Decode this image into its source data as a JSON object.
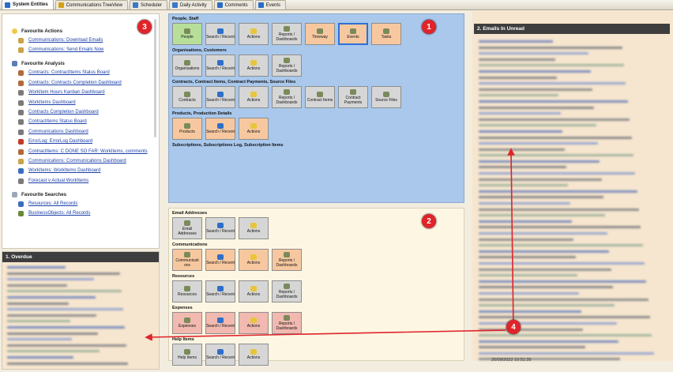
{
  "tabs": [
    {
      "label": "System Entities",
      "icon": "grid-icon",
      "color": "#2b6cc4"
    },
    {
      "label": "Communications TreeView",
      "icon": "envelope-icon",
      "color": "#d4a017"
    },
    {
      "label": "Scheduler",
      "icon": "calendar-icon",
      "color": "#3a78c8"
    },
    {
      "label": "Daily Activity",
      "icon": "calendar-icon",
      "color": "#3a78c8"
    },
    {
      "label": "Comments",
      "icon": "comment-icon",
      "color": "#2b6cc4"
    },
    {
      "label": "Events",
      "icon": "document-icon",
      "color": "#2b6cc4"
    }
  ],
  "favourites": {
    "actions_title": "Favourite Actions",
    "actions": [
      "Communications: Download Emails",
      "Communications: Send Emails Now"
    ],
    "analysis_title": "Favourite Analysis",
    "analysis": [
      "Contracts: ContractItems Status Board",
      "Contracts: Contracts Completion Dashboard",
      "WorkItem Hours Kanban Dashboard",
      "WorkItems Dashboard",
      "Contracts Completion Dashboard",
      "ContractItems Status Board",
      "Communications Dashboard",
      "ErrorLog: ErrorLog Dashboard",
      "ContractItems: C DONE SO FAR: WorkItems, comments",
      "Communications: Communications Dashboard",
      "WorkItems: WorkItems Dashboard",
      "Forecast v Actual WorkItems"
    ],
    "searches_title": "Favourite Searches",
    "searches": [
      "Resources: All Records",
      "BusinessObjects: All Records"
    ]
  },
  "overdue": {
    "title": "1. Overdue"
  },
  "emails": {
    "title": "2. Emails In Unread",
    "last_timestamp": "20/09/2022 10:51:39"
  },
  "groups": {
    "people_staff": {
      "title": "People, Staff",
      "tiles": [
        {
          "label": "People",
          "color": "t-green",
          "icon": "people-icon"
        },
        {
          "label": "Search / Recent",
          "color": "t-grey",
          "icon": "search-icon"
        },
        {
          "label": "Actions",
          "color": "t-grey",
          "icon": "bulb-icon"
        },
        {
          "label": "Reports / Dashboards",
          "color": "t-grey",
          "icon": "chart-icon"
        },
        {
          "label": "Timeway",
          "color": "t-peach",
          "icon": "timeway-icon"
        },
        {
          "label": "Events",
          "color": "t-peach",
          "icon": "events-icon",
          "selected": true
        },
        {
          "label": "Tasks",
          "color": "t-peach",
          "icon": "tasks-icon"
        }
      ]
    },
    "organisations": {
      "title": "Organisations, Customers",
      "tiles": [
        {
          "label": "Organisations",
          "color": "t-grey",
          "icon": "building-icon"
        },
        {
          "label": "Search / Recent",
          "color": "t-grey",
          "icon": "search-icon"
        },
        {
          "label": "Actions",
          "color": "t-grey",
          "icon": "bulb-icon"
        },
        {
          "label": "Reports / Dashboards",
          "color": "t-grey",
          "icon": "chart-icon"
        }
      ]
    },
    "contracts": {
      "title": "Contracts, Contract Items, Contract Payments, Source Files",
      "tiles": [
        {
          "label": "Contracts",
          "color": "t-grey",
          "icon": "contract-icon"
        },
        {
          "label": "Search / Recent",
          "color": "t-grey",
          "icon": "search-icon"
        },
        {
          "label": "Actions",
          "color": "t-grey",
          "icon": "bulb-icon"
        },
        {
          "label": "Reports / Dashboards",
          "color": "t-grey",
          "icon": "chart-icon"
        },
        {
          "label": "Contract Items",
          "color": "t-grey",
          "icon": "contract-icon"
        },
        {
          "label": "Contract Payments",
          "color": "t-grey",
          "icon": "payment-icon"
        },
        {
          "label": "Source Files",
          "color": "t-grey",
          "icon": "folder-icon"
        }
      ]
    },
    "products": {
      "title": "Products, Production Details",
      "tiles": [
        {
          "label": "Products",
          "color": "t-peach",
          "icon": "product-icon"
        },
        {
          "label": "Search / Recent",
          "color": "t-peach",
          "icon": "search-icon"
        },
        {
          "label": "Actions",
          "color": "t-peach",
          "icon": "bulb-icon"
        }
      ]
    },
    "subscriptions": {
      "title": "Subscriptions, Subscriptions Log, Subscription Items"
    },
    "email_addresses": {
      "title": "Email Addresses",
      "tiles": [
        {
          "label": "Email Addresses",
          "color": "t-grey",
          "icon": "email-icon"
        },
        {
          "label": "Search / Recent",
          "color": "t-grey",
          "icon": "search-icon"
        },
        {
          "label": "Actions",
          "color": "t-grey",
          "icon": "bulb-icon"
        }
      ]
    },
    "communications": {
      "title": "Communications",
      "tiles": [
        {
          "label": "Communicati ons",
          "color": "t-peach",
          "icon": "envelope-icon"
        },
        {
          "label": "Search / Recent",
          "color": "t-peach",
          "icon": "search-icon"
        },
        {
          "label": "Actions",
          "color": "t-peach",
          "icon": "bulb-icon"
        },
        {
          "label": "Reports / Dashboards",
          "color": "t-peach",
          "icon": "chart-icon"
        }
      ]
    },
    "resources": {
      "title": "Resources",
      "tiles": [
        {
          "label": "Resources",
          "color": "t-grey",
          "icon": "database-icon"
        },
        {
          "label": "Search / Recent",
          "color": "t-grey",
          "icon": "search-icon"
        },
        {
          "label": "Actions",
          "color": "t-grey",
          "icon": "bulb-icon"
        },
        {
          "label": "Reports / Dashboards",
          "color": "t-grey",
          "icon": "chart-icon"
        }
      ]
    },
    "expenses": {
      "title": "Expenses",
      "tiles": [
        {
          "label": "Expenses",
          "color": "t-salmon",
          "icon": "expense-icon"
        },
        {
          "label": "Search / Recent",
          "color": "t-salmon",
          "icon": "search-icon"
        },
        {
          "label": "Actions",
          "color": "t-salmon",
          "icon": "bulb-icon"
        },
        {
          "label": "Reports / Dashboards",
          "color": "t-salmon",
          "icon": "chart-icon"
        }
      ]
    },
    "help_items": {
      "title": "Help Items",
      "tiles": [
        {
          "label": "Help Items",
          "color": "t-grey",
          "icon": "help-icon"
        },
        {
          "label": "Search / Recent",
          "color": "t-grey",
          "icon": "search-icon"
        },
        {
          "label": "Actions",
          "color": "t-grey",
          "icon": "bulb-icon"
        }
      ]
    }
  },
  "markers": [
    "1",
    "2",
    "3",
    "4"
  ],
  "colors": {
    "accent_red": "#e0242a",
    "link_blue": "#1b3fa8",
    "group_blue": "#a9c8ec"
  }
}
